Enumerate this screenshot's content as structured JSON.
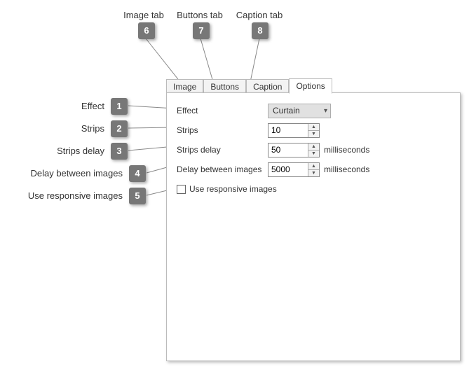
{
  "callouts": {
    "c1": {
      "num": "1",
      "label": "Effect"
    },
    "c2": {
      "num": "2",
      "label": "Strips"
    },
    "c3": {
      "num": "3",
      "label": "Strips delay"
    },
    "c4": {
      "num": "4",
      "label": "Delay between images"
    },
    "c5": {
      "num": "5",
      "label": "Use responsive images"
    },
    "c6": {
      "num": "6",
      "label": "Image tab"
    },
    "c7": {
      "num": "7",
      "label": "Buttons tab"
    },
    "c8": {
      "num": "8",
      "label": "Caption tab"
    }
  },
  "tabs": {
    "image": "Image",
    "buttons": "Buttons",
    "caption": "Caption",
    "options": "Options"
  },
  "form": {
    "effect": {
      "label": "Effect",
      "value": "Curtain"
    },
    "strips": {
      "label": "Strips",
      "value": "10"
    },
    "strips_delay": {
      "label": "Strips delay",
      "value": "50",
      "suffix": "milliseconds"
    },
    "delay_between": {
      "label": "Delay between images",
      "value": "5000",
      "suffix": "milliseconds"
    },
    "responsive": {
      "label": "Use responsive images",
      "checked": false
    }
  }
}
